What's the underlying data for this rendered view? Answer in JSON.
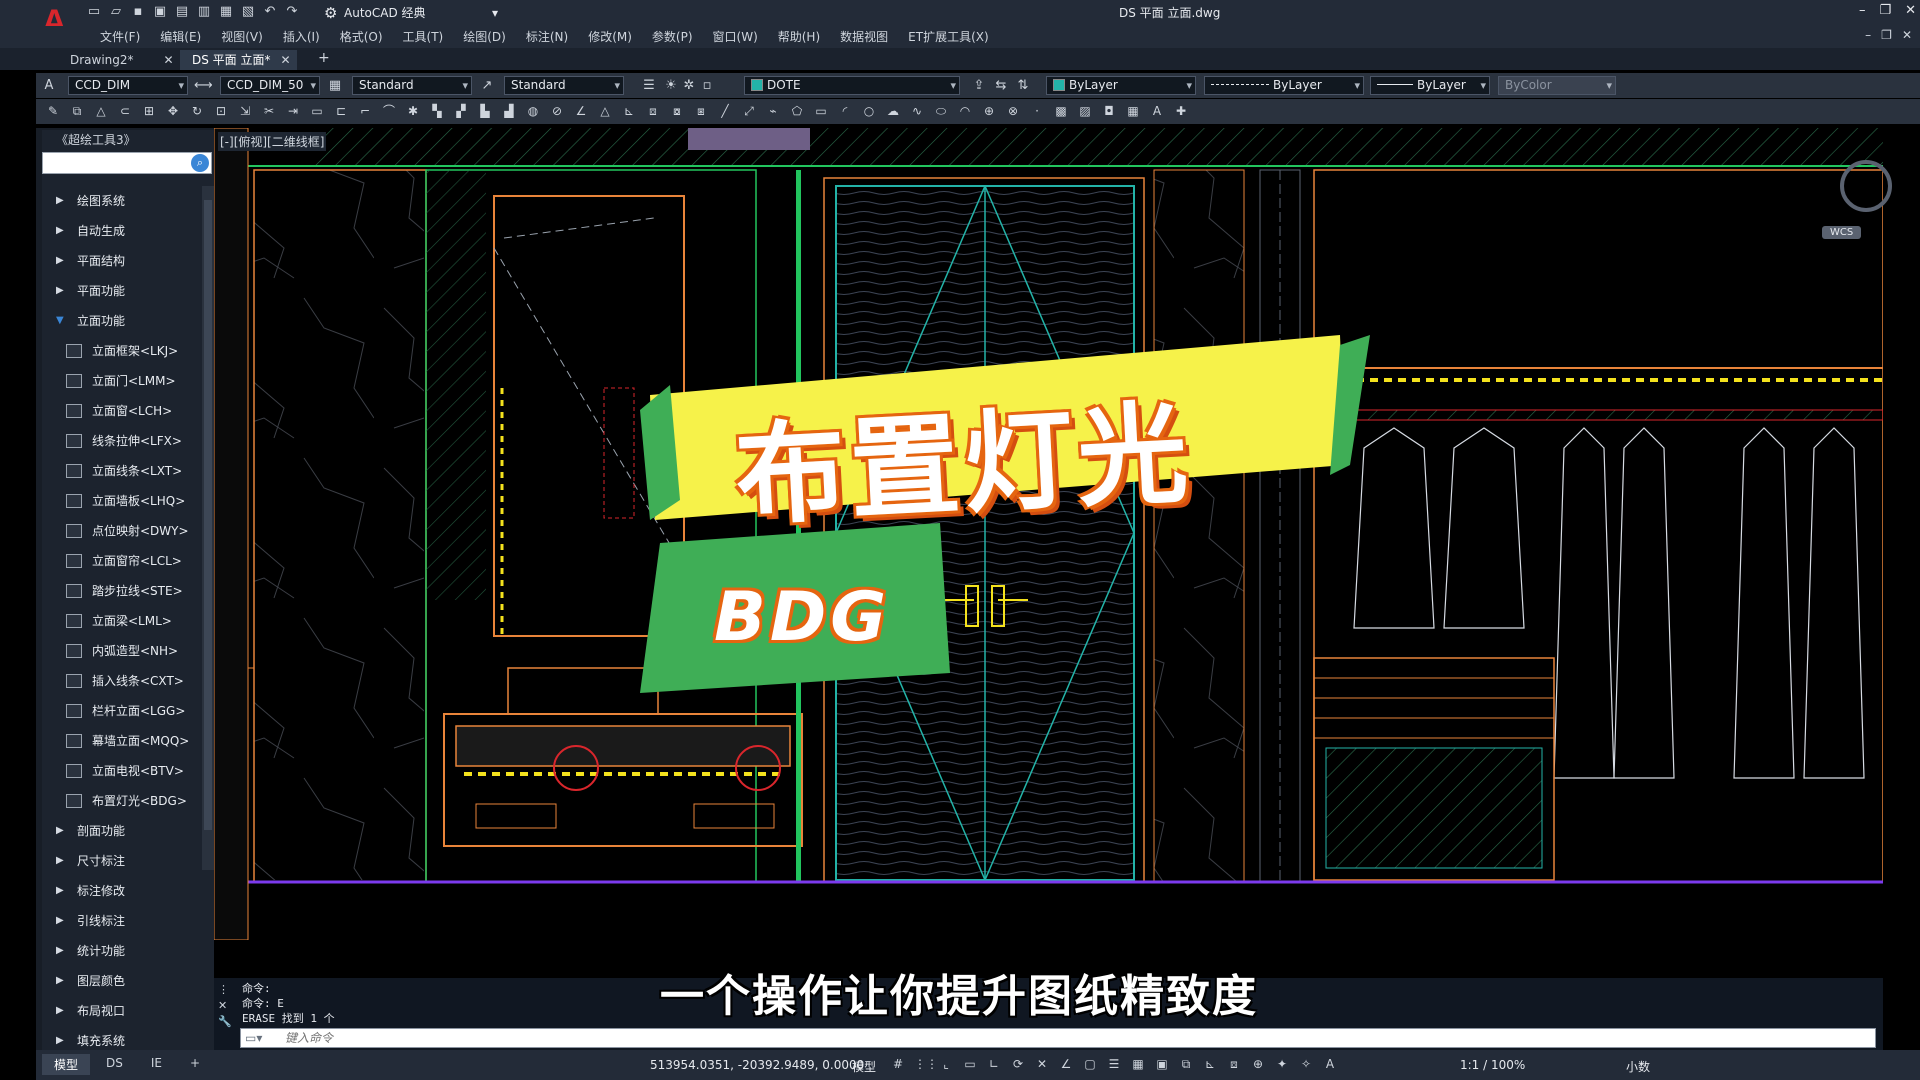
{
  "app": {
    "workspace": "AutoCAD 经典",
    "document_title": "DS 平面 立面.dwg"
  },
  "menu": [
    "文件(F)",
    "编辑(E)",
    "视图(V)",
    "插入(I)",
    "格式(O)",
    "工具(T)",
    "绘图(D)",
    "标注(N)",
    "修改(M)",
    "参数(P)",
    "窗口(W)",
    "帮助(H)",
    "数据视图",
    "ET扩展工具(X)"
  ],
  "doc_tabs": [
    {
      "label": "Drawing2*",
      "active": false
    },
    {
      "label": "DS 平面 立面*",
      "active": true
    }
  ],
  "toolbar": {
    "text_style": "CCD_DIM",
    "dim_style": "CCD_DIM_50",
    "table_style": "Standard",
    "multileader_style": "Standard",
    "layer": "DOTE",
    "color": "ByLayer",
    "linetype": "ByLayer",
    "lineweight": "ByLayer",
    "plot_style": "ByColor"
  },
  "palette": {
    "title": "《超绘工具3》",
    "items": [
      {
        "label": "绘图系统",
        "type": "group",
        "expanded": false
      },
      {
        "label": "自动生成",
        "type": "group",
        "expanded": false
      },
      {
        "label": "平面结构",
        "type": "group",
        "expanded": false
      },
      {
        "label": "平面功能",
        "type": "group",
        "expanded": false
      },
      {
        "label": "立面功能",
        "type": "group",
        "expanded": true
      },
      {
        "label": "立面框架<LKJ>",
        "type": "sub"
      },
      {
        "label": "立面门<LMM>",
        "type": "sub"
      },
      {
        "label": "立面窗<LCH>",
        "type": "sub"
      },
      {
        "label": "线条拉伸<LFX>",
        "type": "sub"
      },
      {
        "label": "立面线条<LXT>",
        "type": "sub"
      },
      {
        "label": "立面墙板<LHQ>",
        "type": "sub"
      },
      {
        "label": "点位映射<DWY>",
        "type": "sub"
      },
      {
        "label": "立面窗帘<LCL>",
        "type": "sub"
      },
      {
        "label": "踏步拉线<STE>",
        "type": "sub"
      },
      {
        "label": "立面梁<LML>",
        "type": "sub"
      },
      {
        "label": "内弧造型<NH>",
        "type": "sub"
      },
      {
        "label": "插入线条<CXT>",
        "type": "sub"
      },
      {
        "label": "栏杆立面<LGG>",
        "type": "sub"
      },
      {
        "label": "幕墙立面<MQQ>",
        "type": "sub"
      },
      {
        "label": "立面电视<BTV>",
        "type": "sub"
      },
      {
        "label": "布置灯光<BDG>",
        "type": "sub"
      },
      {
        "label": "剖面功能",
        "type": "group",
        "expanded": false
      },
      {
        "label": "尺寸标注",
        "type": "group",
        "expanded": false
      },
      {
        "label": "标注修改",
        "type": "group",
        "expanded": false
      },
      {
        "label": "引线标注",
        "type": "group",
        "expanded": false
      },
      {
        "label": "统计功能",
        "type": "group",
        "expanded": false
      },
      {
        "label": "图层颜色",
        "type": "group",
        "expanded": false
      },
      {
        "label": "布局视口",
        "type": "group",
        "expanded": false
      },
      {
        "label": "填充系统",
        "type": "group",
        "expanded": false
      }
    ]
  },
  "viewport_label": "[-][俯视][二维线框]",
  "viewcube": {
    "wcs_label": "WCS"
  },
  "overlay": {
    "title": "布置灯光",
    "badge": "BDG",
    "subtitle": "一个操作让你提升图纸精致度"
  },
  "command": {
    "lines": [
      "命令:",
      "命令: E",
      "ERASE 找到 1 个"
    ],
    "placeholder": "键入命令"
  },
  "status": {
    "layout_tabs": [
      "模型",
      "DS",
      "IE"
    ],
    "coordinates": "513954.0351, -20392.9489, 0.0000",
    "mode": "模型",
    "scale": "1:1 / 100%",
    "units": "小数"
  },
  "colors": {
    "accent_orange": "#e56510",
    "banner_yellow": "#f6f24a",
    "badge_green": "#3fae56",
    "cad_green": "#22c55e",
    "cad_orange": "#e8843a",
    "cad_cyan": "#23b3a8",
    "led_yellow": "#f4e21d"
  }
}
